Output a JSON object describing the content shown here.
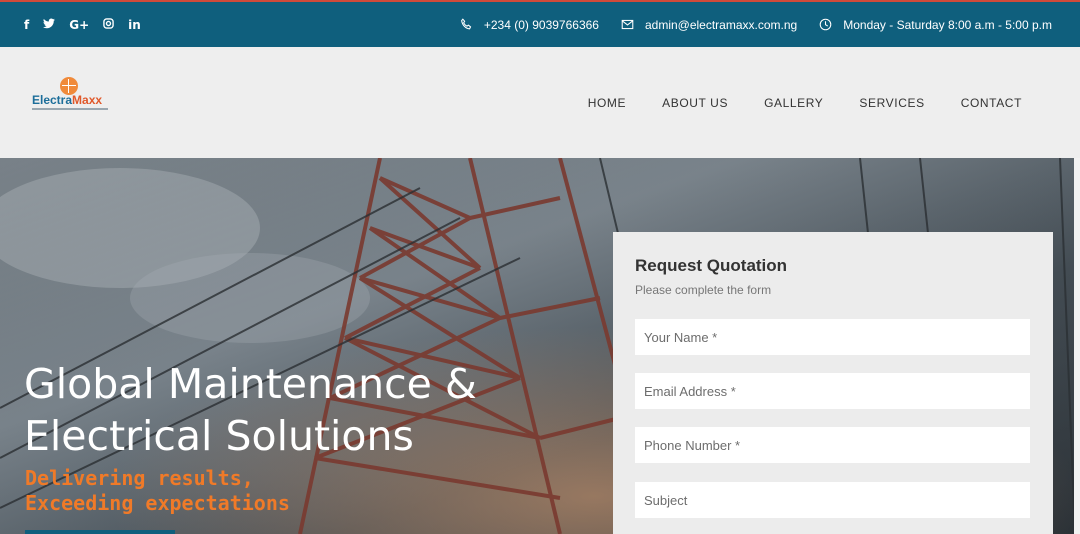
{
  "topbar": {
    "social": [
      {
        "icon": "facebook-icon",
        "glyph": "f"
      },
      {
        "icon": "twitter-icon",
        "glyph": "🐦"
      },
      {
        "icon": "google-plus-icon",
        "glyph": "G+"
      },
      {
        "icon": "instagram-icon",
        "glyph": "◎"
      },
      {
        "icon": "linkedin-icon",
        "glyph": "in"
      }
    ],
    "phone": "+234 (0) 9039766366",
    "email": "admin@electramaxx.com.ng",
    "hours": "Monday - Saturday 8:00 a.m - 5:00 p.m"
  },
  "logo": {
    "part1": "Electra",
    "part2": "Maxx"
  },
  "nav": {
    "items": [
      "HOME",
      "ABOUT US",
      "GALLERY",
      "SERVICES",
      "CONTACT"
    ]
  },
  "hero": {
    "title_line1": "Global Maintenance &",
    "title_line2": "Electrical Solutions",
    "subtitle_line1": "Delivering results,",
    "subtitle_line2": "Exceeding expectations"
  },
  "quote": {
    "title": "Request Quotation",
    "subtitle": "Please complete the form",
    "fields": [
      {
        "placeholder": "Your Name *"
      },
      {
        "placeholder": "Email Address *"
      },
      {
        "placeholder": "Phone Number *"
      },
      {
        "placeholder": "Subject"
      }
    ]
  },
  "colors": {
    "topbar": "#0f5f7d",
    "accent_orange": "#f07a28",
    "logo_blue": "#1c6e9a"
  }
}
